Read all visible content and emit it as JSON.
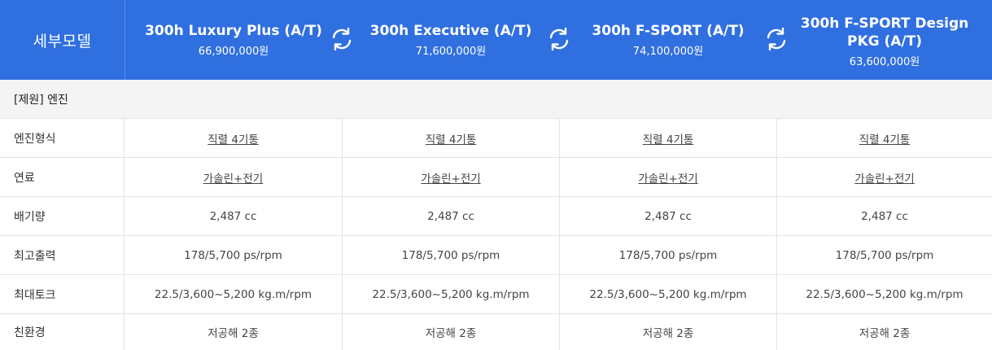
{
  "header": {
    "label": "세부모델",
    "models": [
      {
        "name": "300h Luxury Plus (A/T)",
        "price": "66,900,000원"
      },
      {
        "name": "300h Executive (A/T)",
        "price": "71,600,000원"
      },
      {
        "name": "300h F-SPORT (A/T)",
        "price": "74,100,000원"
      },
      {
        "name": "300h F-SPORT Design PKG (A/T)",
        "price": "63,600,000원"
      }
    ],
    "swap_icon": "refresh-icon"
  },
  "section": {
    "title": "[제원] 엔진"
  },
  "rows": [
    {
      "label": "엔진형식",
      "values": [
        "직렬 4기통",
        "직렬 4기통",
        "직렬 4기통",
        "직렬 4기통"
      ],
      "link": true
    },
    {
      "label": "연료",
      "values": [
        "가솔린+전기",
        "가솔린+전기",
        "가솔린+전기",
        "가솔린+전기"
      ],
      "link": true
    },
    {
      "label": "배기량",
      "values": [
        "2,487 cc",
        "2,487 cc",
        "2,487 cc",
        "2,487 cc"
      ]
    },
    {
      "label": "최고출력",
      "values": [
        "178/5,700 ps/rpm",
        "178/5,700 ps/rpm",
        "178/5,700 ps/rpm",
        "178/5,700 ps/rpm"
      ]
    },
    {
      "label": "최대토크",
      "values": [
        "22.5/3,600~5,200 kg.m/rpm",
        "22.5/3,600~5,200 kg.m/rpm",
        "22.5/3,600~5,200 kg.m/rpm",
        "22.5/3,600~5,200 kg.m/rpm"
      ]
    },
    {
      "label": "친환경",
      "values": [
        "저공해 2종",
        "저공해 2종",
        "저공해 2종",
        "저공해 2종"
      ]
    }
  ],
  "colors": {
    "header_bg": "#2f6fe0",
    "section_bg": "#f4f4f4",
    "border": "#e2e2e2"
  }
}
